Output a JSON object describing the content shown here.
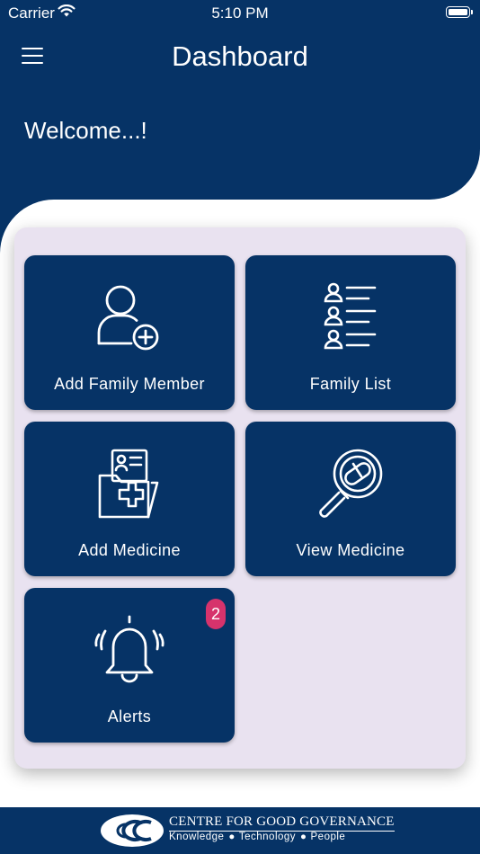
{
  "status_bar": {
    "carrier": "Carrier",
    "time": "5:10 PM"
  },
  "header": {
    "title": "Dashboard",
    "welcome": "Welcome...!"
  },
  "tiles": [
    {
      "label": "Add Family Member",
      "icon": "add-user-icon"
    },
    {
      "label": "Family List",
      "icon": "family-list-icon"
    },
    {
      "label": "Add Medicine",
      "icon": "medical-folder-icon"
    },
    {
      "label": "View Medicine",
      "icon": "pill-magnifier-icon"
    },
    {
      "label": "Alerts",
      "icon": "bell-icon",
      "badge": "2"
    }
  ],
  "footer": {
    "org_name": "CENTRE FOR GOOD GOVERNANCE",
    "tagline": [
      "Knowledge",
      "Technology",
      "People"
    ]
  },
  "colors": {
    "primary": "#063366",
    "panel": "#e9e2f0",
    "badge": "#d6336c"
  }
}
